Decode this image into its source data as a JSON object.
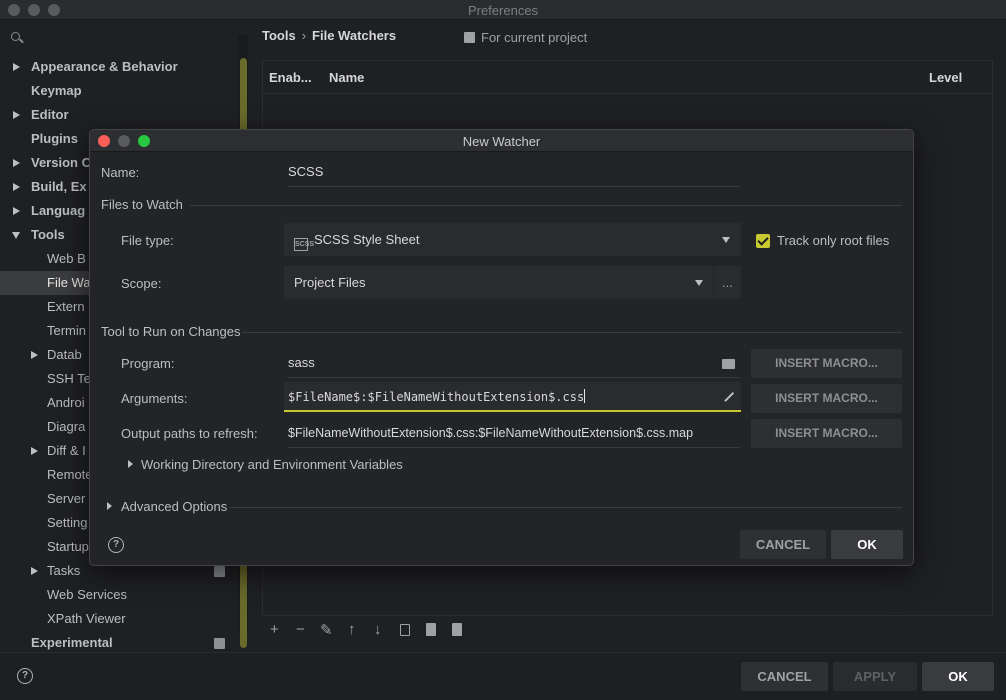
{
  "window": {
    "title": "Preferences"
  },
  "sidebar": {
    "search_placeholder": "",
    "items": [
      {
        "label": "Appearance & Behavior"
      },
      {
        "label": "Keymap"
      },
      {
        "label": "Editor"
      },
      {
        "label": "Plugins"
      },
      {
        "label": "Version C"
      },
      {
        "label": "Build, Ex"
      },
      {
        "label": "Languag"
      },
      {
        "label": "Tools"
      },
      {
        "label": "Web B"
      },
      {
        "label": "File Wa"
      },
      {
        "label": "Extern"
      },
      {
        "label": "Termin"
      },
      {
        "label": "Datab"
      },
      {
        "label": "SSH Te"
      },
      {
        "label": "Androi"
      },
      {
        "label": "Diagra"
      },
      {
        "label": "Diff & I"
      },
      {
        "label": "Remote"
      },
      {
        "label": "Server"
      },
      {
        "label": "Setting"
      },
      {
        "label": "Startup"
      },
      {
        "label": "Tasks"
      },
      {
        "label": "Web Services"
      },
      {
        "label": "XPath Viewer"
      },
      {
        "label": "Experimental"
      }
    ]
  },
  "main": {
    "breadcrumb": [
      "Tools",
      "File Watchers"
    ],
    "breadcrumb_sep": "›",
    "for_current_project": "For current project",
    "table": {
      "columns": [
        "Enab...",
        "Name",
        "Level"
      ]
    },
    "toolbar": [
      "+",
      "−",
      "✎",
      "↑",
      "↓"
    ]
  },
  "footer": {
    "cancel": "CANCEL",
    "apply": "APPLY",
    "ok": "OK",
    "help": "?"
  },
  "dialog": {
    "title": "New Watcher",
    "name_label": "Name:",
    "name_value": "SCSS",
    "files_to_watch": "Files to Watch",
    "file_type_label": "File type:",
    "file_type_icon_text": "SCSS",
    "file_type_value": "SCSS Style Sheet",
    "track_root_label": "Track only root files",
    "track_root_checked": true,
    "scope_label": "Scope:",
    "scope_value": "Project Files",
    "scope_more": "...",
    "tool_section": "Tool to Run on Changes",
    "program_label": "Program:",
    "program_value": "sass",
    "arguments_label": "Arguments:",
    "arguments_value": "$FileName$:$FileNameWithoutExtension$.css",
    "output_label": "Output paths to refresh:",
    "output_value": "$FileNameWithoutExtension$.css:$FileNameWithoutExtension$.css.map",
    "insert_macro": "INSERT MACRO...",
    "working_dir": "Working Directory and Environment Variables",
    "advanced": "Advanced Options",
    "cancel": "CANCEL",
    "ok": "OK",
    "help": "?"
  },
  "colors": {
    "accent": "#c8c830",
    "close": "#fc5f57",
    "minimize": "#fdbc2e",
    "maximize": "#28c840"
  }
}
